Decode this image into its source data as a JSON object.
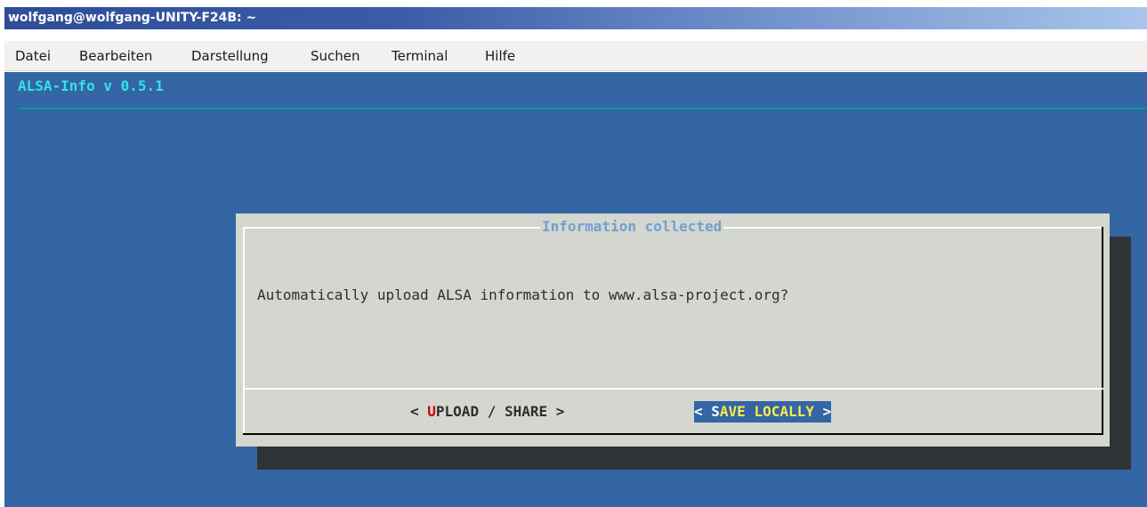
{
  "window": {
    "title": "wolfgang@wolfgang-UNITY-F24B: ~"
  },
  "menubar": {
    "items": [
      "Datei",
      "Bearbeiten",
      "Darstellung",
      "Suchen",
      "Terminal",
      "Hilfe"
    ]
  },
  "terminal": {
    "title": "ALSA-Info v 0.5.1",
    "background_color": "#3465a4"
  },
  "dialog": {
    "title": "Information collected",
    "message": "Automatically upload ALSA information to www.alsa-project.org?",
    "buttons": {
      "upload": {
        "open": "< ",
        "hotkey": "U",
        "rest": "PLOAD / SHARE >"
      },
      "save": {
        "open": "< ",
        "hotkey": "S",
        "rest": "AVE LOCALLY",
        "close": " >"
      }
    }
  }
}
